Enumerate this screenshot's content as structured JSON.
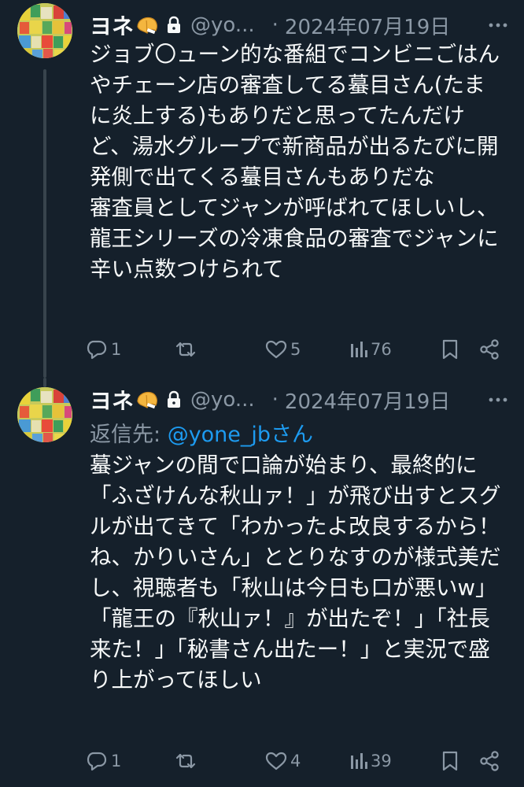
{
  "tweets": [
    {
      "display_name": "ヨネ",
      "handle": "@yo...",
      "separator": "·",
      "date": "2024年07月19日",
      "text": "ジョブ〇ューン的な番組でコンビニごはんやチェーン店の審査してる蟇目さん(たまに炎上する)もありだと思ってたんだけど、湯水グループで新商品が出るたびに開発側で出てくる蟇目さんもありだな\n審査員としてジャンが呼ばれてほしいし、龍王シリーズの冷凍食品の審査でジャンに辛い点数つけられて",
      "stats": {
        "replies": "1",
        "reposts": "",
        "likes": "5",
        "views": "76"
      }
    },
    {
      "display_name": "ヨネ",
      "handle": "@yo...",
      "separator": "·",
      "date": "2024年07月19日",
      "reply_prefix": "返信先: ",
      "reply_handle": "@yone_jbさん",
      "text": "蟇ジャンの間で口論が始まり、最終的に「ふざけんな秋山ァ！」が飛び出すとスグルが出てきて「わかったよ改良するから！ね、かりいさん」ととりなすのが様式美だし、視聴者も「秋山は今日も口が悪いw」「龍王の『秋山ァ！』が出たぞ！」「社長来た！」「秘書さん出たー！」と実況で盛り上がってほしい",
      "stats": {
        "replies": "1",
        "reposts": "",
        "likes": "4",
        "views": "39"
      }
    }
  ],
  "icons": {
    "badge": "fortune-cookie-icon",
    "protected": "lock-icon",
    "more": "more-icon",
    "reply": "reply-icon",
    "repost": "repost-icon",
    "like": "heart-icon",
    "views": "views-chart-icon",
    "bookmark": "bookmark-icon",
    "share": "share-icon"
  },
  "colors": {
    "background": "#15202b",
    "text": "#f7f9f9",
    "muted": "#8b98a5",
    "link": "#1d9bf0",
    "thread_line": "#38444d"
  }
}
